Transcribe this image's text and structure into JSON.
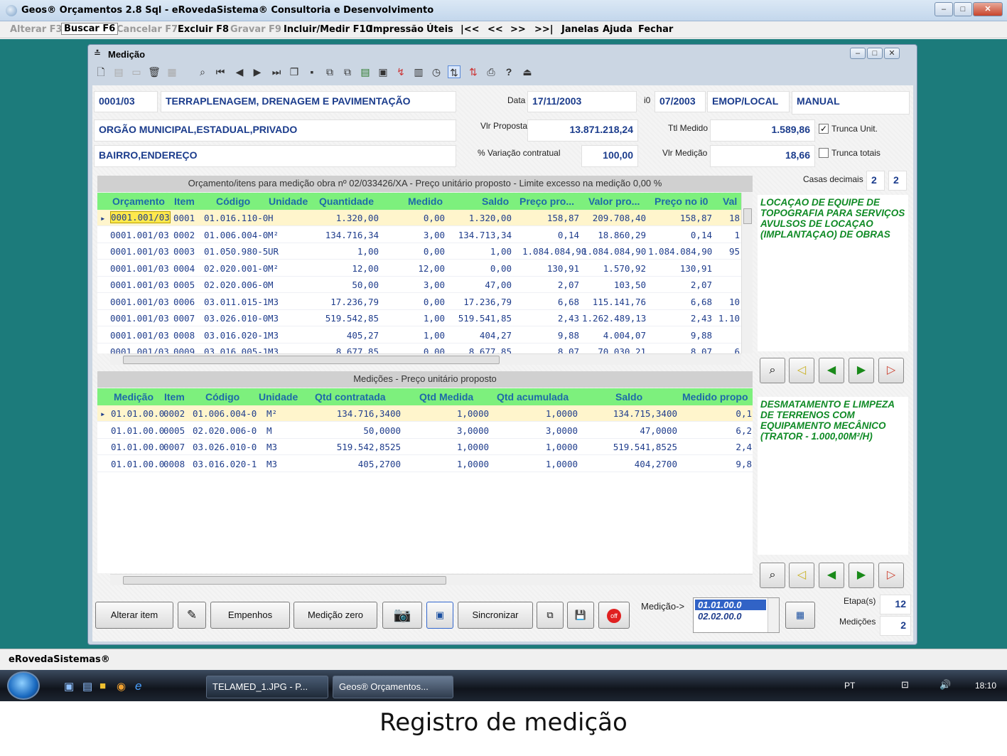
{
  "window": {
    "title": "Geos® Orçamentos 2.8 Sql - eRovedaSistema® Consultoria e Desenvolvimento"
  },
  "menu": [
    "Alterar F3",
    "Buscar F6",
    "Cancelar F7",
    "Excluir F8",
    "Gravar F9",
    "Incluir/Medir F10",
    "Impressão",
    "Úteis",
    "|<<",
    "<<",
    ">>",
    ">>|",
    "Janelas",
    "Ajuda",
    "Fechar"
  ],
  "child": {
    "title": "Medição"
  },
  "header": {
    "code": "0001/03",
    "obra": "TERRAPLENAGEM, DRENAGEM E PAVIMENTAÇÃO",
    "data_label": "Data",
    "data": "17/11/2003",
    "i0_label": "i0",
    "i0": "07/2003",
    "base": "EMOP/LOCAL",
    "tipo": "MANUAL",
    "orgao": "ORGÃO MUNICIPAL,ESTADUAL,PRIVADO",
    "vlr_proposta_label": "Vlr Proposta",
    "vlr_proposta": "13.871.218,24",
    "ttl_medido_label": "Ttl Medido",
    "ttl_medido": "1.589,86",
    "trunca_unit": "Trunca Unit.",
    "endereco": "BAIRRO,ENDEREÇO",
    "variacao_label": "% Variação contratual",
    "variacao": "100,00",
    "vlr_medicao_label": "Vlr Medição",
    "vlr_medicao": "18,66",
    "trunca_totais": "Trunca totais",
    "casas_label": "Casas decimais",
    "casas1": "2",
    "casas2": "2"
  },
  "grid1": {
    "caption": "Orçamento/itens para medição obra nº 02/033426/XA - Preço unitário proposto - Limite excesso na medição 0,00 %",
    "columns": [
      "Orçamento",
      "Item",
      "Código",
      "Unidade",
      "Quantidade",
      "Medido",
      "Saldo",
      "Preço pro...",
      "Valor pro...",
      "Preço no i0",
      "Val"
    ],
    "rows": [
      [
        "0001.001/03",
        "0001",
        "01.016.110-0",
        "H",
        "1.320,00",
        "0,00",
        "1.320,00",
        "158,87",
        "209.708,40",
        "158,87",
        "18"
      ],
      [
        "0001.001/03",
        "0002",
        "01.006.004-0",
        "M²",
        "134.716,34",
        "3,00",
        "134.713,34",
        "0,14",
        "18.860,29",
        "0,14",
        "1"
      ],
      [
        "0001.001/03",
        "0003",
        "01.050.980-5",
        "UR",
        "1,00",
        "0,00",
        "1,00",
        "1.084.084,90",
        "1.084.084,90",
        "1.084.084,90",
        "95"
      ],
      [
        "0001.001/03",
        "0004",
        "02.020.001-0",
        "M²",
        "12,00",
        "12,00",
        "0,00",
        "130,91",
        "1.570,92",
        "130,91",
        ""
      ],
      [
        "0001.001/03",
        "0005",
        "02.020.006-0",
        "M",
        "50,00",
        "3,00",
        "47,00",
        "2,07",
        "103,50",
        "2,07",
        ""
      ],
      [
        "0001.001/03",
        "0006",
        "03.011.015-1",
        "M3",
        "17.236,79",
        "0,00",
        "17.236,79",
        "6,68",
        "115.141,76",
        "6,68",
        "10"
      ],
      [
        "0001.001/03",
        "0007",
        "03.026.010-0",
        "M3",
        "519.542,85",
        "1,00",
        "519.541,85",
        "2,43",
        "1.262.489,13",
        "2,43",
        "1.10"
      ],
      [
        "0001.001/03",
        "0008",
        "03.016.020-1",
        "M3",
        "405,27",
        "1,00",
        "404,27",
        "9,88",
        "4.004,07",
        "9,88",
        ""
      ],
      [
        "0001.001/03",
        "0009",
        "03.016.005-1",
        "M3",
        "8.677,85",
        "0,00",
        "8.677,85",
        "8,07",
        "70.030,21",
        "8,07",
        "6"
      ]
    ],
    "memo": "LOCAÇAO DE EQUIPE DE TOPOGRAFIA PARA SERVIÇOS AVULSOS DE LOCAÇAO (IMPLANTAÇAO) DE OBRAS"
  },
  "grid2": {
    "caption": "Medições - Preço unitário proposto",
    "columns": [
      "Medição",
      "Item",
      "Código",
      "Unidade",
      "Qtd contratada",
      "Qtd Medida",
      "Qtd acumulada",
      "Saldo",
      "Medido propo"
    ],
    "rows": [
      [
        "01.01.00.0",
        "0002",
        "01.006.004-0",
        "M²",
        "134.716,3400",
        "1,0000",
        "1,0000",
        "134.715,3400",
        "0,1"
      ],
      [
        "01.01.00.0",
        "0005",
        "02.020.006-0",
        "M",
        "50,0000",
        "3,0000",
        "3,0000",
        "47,0000",
        "6,2"
      ],
      [
        "01.01.00.0",
        "0007",
        "03.026.010-0",
        "M3",
        "519.542,8525",
        "1,0000",
        "1,0000",
        "519.541,8525",
        "2,4"
      ],
      [
        "01.01.00.0",
        "0008",
        "03.016.020-1",
        "M3",
        "405,2700",
        "1,0000",
        "1,0000",
        "404,2700",
        "9,8"
      ]
    ],
    "memo": "DESMATAMENTO E LIMPEZA DE TERRENOS COM EQUIPAMENTO MECÂNICO (TRATOR - 1.000,00M²/H)"
  },
  "bottom": {
    "alterar_item": "Alterar item",
    "empenhos": "Empenhos",
    "medicao_zero": "Medição zero",
    "sincronizar": "Sincronizar",
    "medicao_label": "Medição->",
    "medicoes_list": [
      "01.01.00.0",
      "02.02.00.0"
    ],
    "etapas_label": "Etapa(s)",
    "etapas": "12",
    "medicoes_label": "Medições",
    "medicoes": "2"
  },
  "statusbar": "eRovedaSistemas®",
  "taskbar": {
    "task1": "TELAMED_1.JPG - P...",
    "task2": "Geos® Orçamentos...",
    "lang": "PT",
    "clock": "18:10"
  },
  "caption": "Registro de medição"
}
